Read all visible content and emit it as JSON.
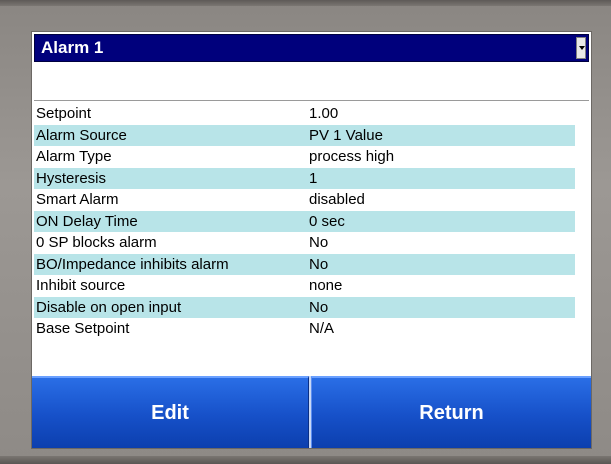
{
  "title": "Alarm 1",
  "rows": [
    {
      "label": "Setpoint",
      "value": "1.00"
    },
    {
      "label": "Alarm Source",
      "value": "PV 1 Value"
    },
    {
      "label": "Alarm Type",
      "value": "process high"
    },
    {
      "label": "Hysteresis",
      "value": "1"
    },
    {
      "label": "Smart Alarm",
      "value": "disabled"
    },
    {
      "label": "ON Delay Time",
      "value": "0 sec"
    },
    {
      "label": "0 SP blocks alarm",
      "value": "No"
    },
    {
      "label": "BO/Impedance inhibits alarm",
      "value": "No"
    },
    {
      "label": "Inhibit source",
      "value": "none"
    },
    {
      "label": "Disable on open input",
      "value": "No"
    },
    {
      "label": "Base Setpoint",
      "value": "N/A"
    }
  ],
  "buttons": {
    "edit_label": "Edit",
    "return_label": "Return"
  },
  "colors": {
    "title_bg": "#00007c",
    "row_shade": "#b8e4e8",
    "button_blue": "#1650c8",
    "bezel": "#9c9894"
  }
}
